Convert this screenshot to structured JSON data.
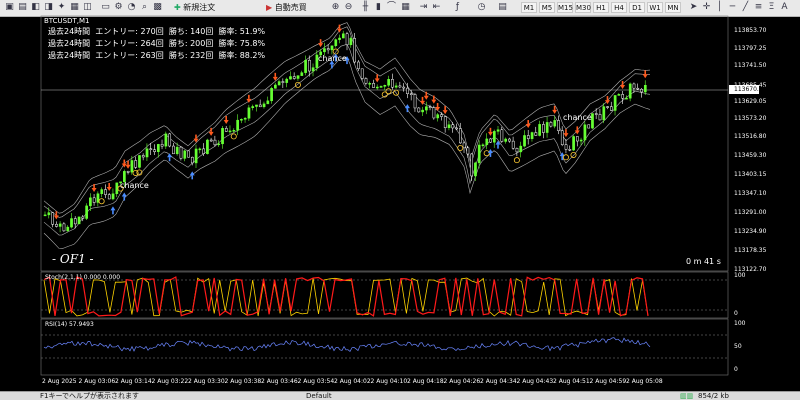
{
  "toolbar": {
    "new_order": "新規注文",
    "auto_trading": "自動売買",
    "timeframes": [
      "M1",
      "M5",
      "M15",
      "M30",
      "H1",
      "H4",
      "D1",
      "W1",
      "MN"
    ],
    "active_timeframe": "M1"
  },
  "chart": {
    "symbol": "BTCUSDT,M1",
    "stats": [
      "過去24時間  エントリー: 270回  勝ち: 140回  勝率: 51.9%",
      "過去24時間  エントリー: 264回  勝ち: 200回  勝率: 75.8%",
      "過去24時間  エントリー: 263回  勝ち: 232回  勝率: 88.2%"
    ],
    "price_labels": [
      "113853.70",
      "113797.25",
      "113741.50",
      "113685.45",
      "113670.30",
      "113629.05",
      "113573.20",
      "113516.80",
      "113459.30",
      "113403.15",
      "113347.10",
      "113291.00",
      "113234.90",
      "113178.35",
      "113122.70"
    ],
    "current_price": "113670.30",
    "chance_labels": [
      "chance",
      "chance",
      "chance"
    ],
    "countdown": "0 m 41 s",
    "watermark": "- OF1 -",
    "time_labels": [
      "2 Aug 2025",
      "2 Aug 03:06",
      "2 Aug 03:14",
      "2 Aug 03:22",
      "2 Aug 03:30",
      "2 Aug 03:38",
      "2 Aug 03:46",
      "2 Aug 03:54",
      "2 Aug 04:02",
      "2 Aug 04:10",
      "2 Aug 04:18",
      "2 Aug 04:26",
      "2 Aug 04:34",
      "2 Aug 04:43",
      "2 Aug 04:51",
      "2 Aug 04:59",
      "2 Aug 05:08"
    ]
  },
  "stoch": {
    "label": "Stoch(2,1,1) 0.000 0.000",
    "scale": [
      "100",
      "0"
    ]
  },
  "rsi": {
    "label": "RSI(14) 57.9493",
    "scale": [
      "100",
      "50",
      "0"
    ]
  },
  "status": {
    "help": "F1キーでヘルプが表示されます",
    "profile": "Default",
    "traffic": "854/2 kb"
  },
  "colors": {
    "bull": "#66ff33",
    "bear": "#ffffff",
    "sell_arrow": "#ff5a1e",
    "buy_arrow": "#4a8cff",
    "circle": "#ffcc33",
    "band": "#cfcfcf",
    "stoch_main": "#ff1a1a",
    "stoch_signal": "#ffd400",
    "rsi": "#6a86ff"
  }
}
